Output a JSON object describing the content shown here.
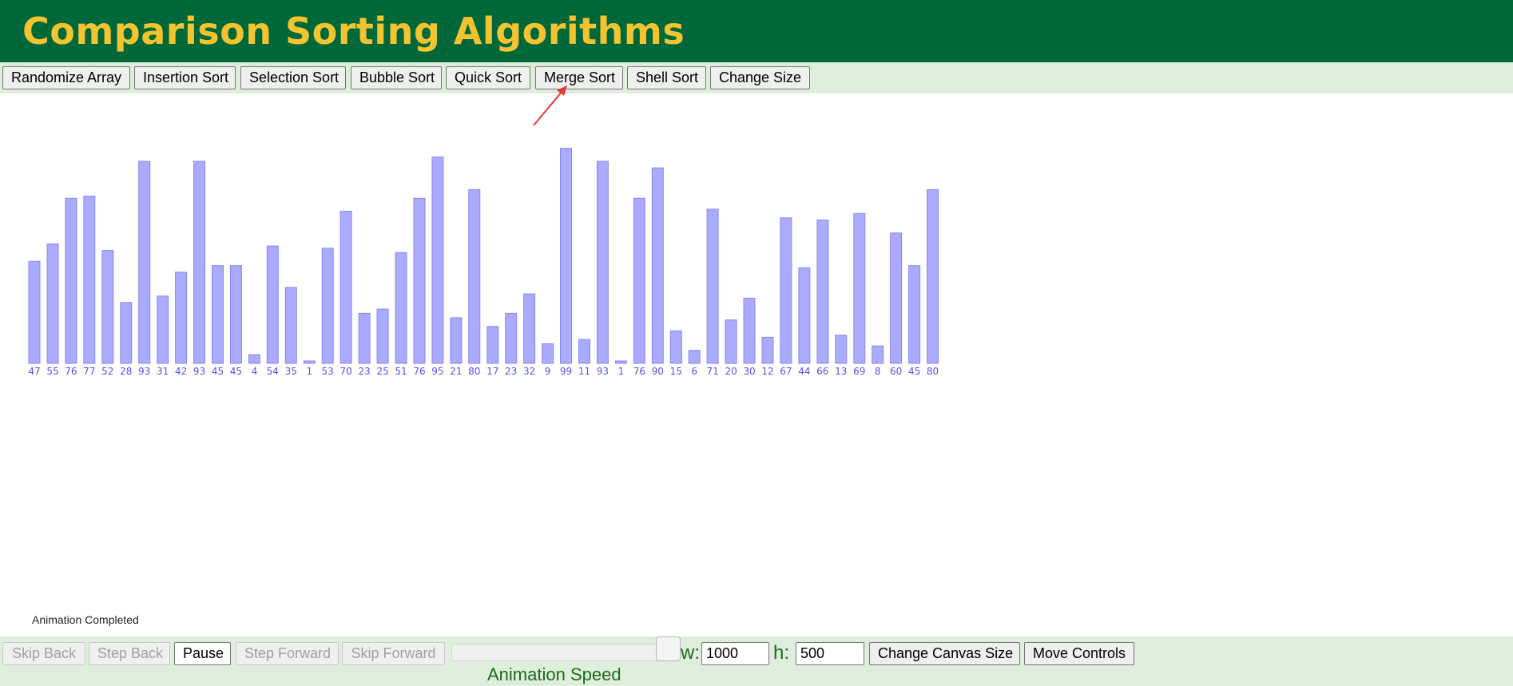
{
  "header": {
    "title": "Comparison Sorting Algorithms"
  },
  "toolbar": {
    "buttons": [
      "Randomize Array",
      "Insertion Sort",
      "Selection Sort",
      "Bubble Sort",
      "Quick Sort",
      "Merge Sort",
      "Shell Sort",
      "Change Size"
    ]
  },
  "array": {
    "values": [
      47,
      55,
      76,
      77,
      52,
      28,
      93,
      31,
      42,
      93,
      45,
      45,
      4,
      54,
      35,
      1,
      53,
      70,
      23,
      25,
      51,
      76,
      95,
      21,
      80,
      17,
      23,
      32,
      9,
      99,
      11,
      93,
      1,
      76,
      90,
      15,
      6,
      71,
      20,
      30,
      12,
      67,
      44,
      66,
      13,
      69,
      8,
      60,
      45,
      80
    ],
    "bar_fill": "#aaaaff",
    "bar_stroke": "#8888ee",
    "label_color": "#5252ee"
  },
  "status": {
    "message": "Animation Completed"
  },
  "controls": {
    "skip_back": "Skip Back",
    "step_back": "Step Back",
    "pause": "Pause",
    "step_forward": "Step Forward",
    "skip_forward": "Skip Forward",
    "speed_label": "Animation Speed",
    "width_label": "w:",
    "width_value": "1000",
    "height_label": "h:",
    "height_value": "500",
    "change_canvas": "Change Canvas Size",
    "move_controls": "Move Controls"
  },
  "annotation": {
    "arrow_color": "#e53935"
  },
  "colors": {
    "header_bg": "#006838",
    "title": "#f4c430",
    "toolbar_bg": "#dfeedc"
  }
}
